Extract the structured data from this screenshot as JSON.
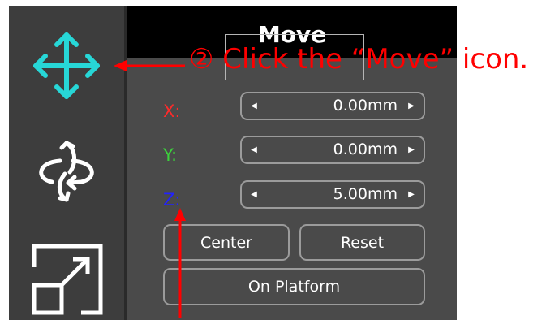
{
  "toolbar": {
    "tools": [
      {
        "name": "move",
        "icon": "move-arrows-icon",
        "active": true
      },
      {
        "name": "rotate",
        "icon": "rotate-icon",
        "active": false
      },
      {
        "name": "scale",
        "icon": "scale-icon",
        "active": false
      }
    ]
  },
  "panel": {
    "title": "Move",
    "axes": [
      {
        "label": "X:",
        "value": "0.00mm",
        "color": "#ff2a2a"
      },
      {
        "label": "Y:",
        "value": "0.00mm",
        "color": "#3cd23c"
      },
      {
        "label": "Z:",
        "value": "5.00mm",
        "color": "#2222ff"
      }
    ],
    "buttons": {
      "center": "Center",
      "reset": "Reset",
      "on_platform": "On Platform"
    }
  },
  "annotation": {
    "text": "② Click the “Move” icon.",
    "color": "#ff0000"
  },
  "colors": {
    "accent_icon": "#27d7d7",
    "panel_bg": "#4a4a4a",
    "toolbar_bg": "#3d3d3d",
    "header_bg": "#000000"
  }
}
